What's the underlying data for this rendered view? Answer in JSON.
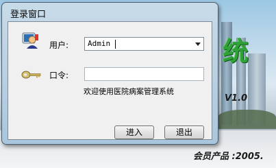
{
  "background": {
    "title": "统",
    "version": "V1.0",
    "footer": "会员产品 :2005."
  },
  "dialog": {
    "title": "登录窗口",
    "user_label": "用户:",
    "user_value": "Admin",
    "password_label": "口令:",
    "password_value": "",
    "welcome_text": "欢迎使用医院病案管理系统",
    "login_button": "进入",
    "exit_button": "退出"
  },
  "icons": {
    "user": "user-avatar-icon",
    "key": "key-icon",
    "dropdown": "chevron-down-icon"
  }
}
